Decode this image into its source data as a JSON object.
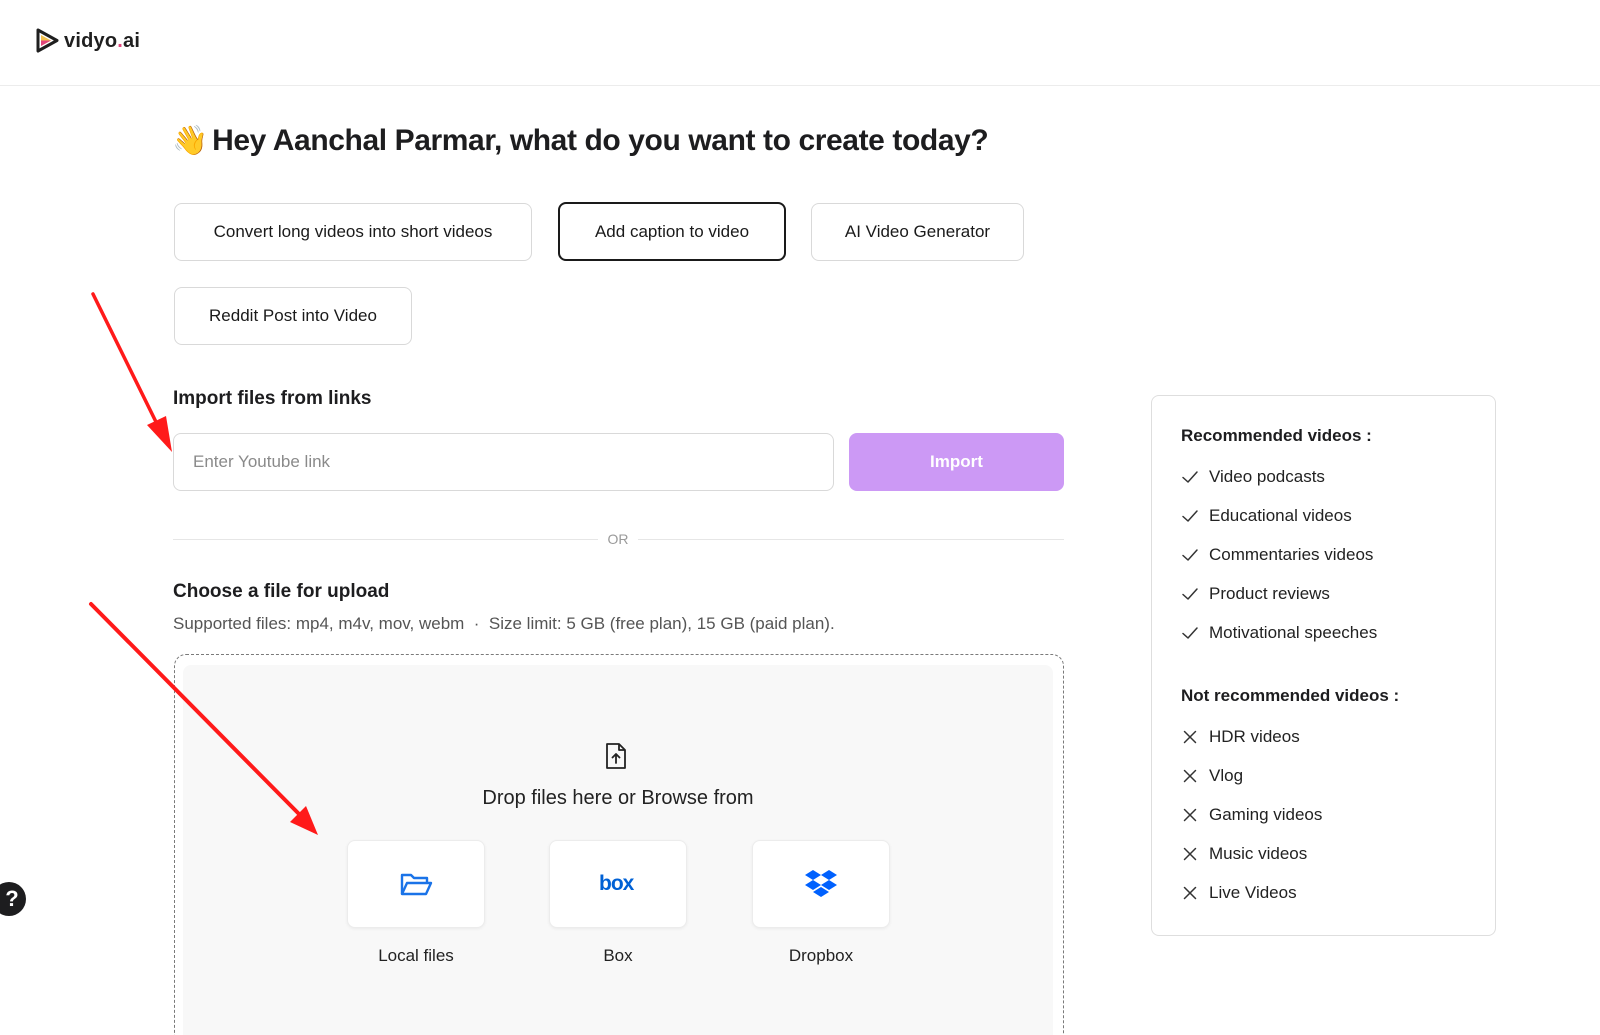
{
  "header": {
    "logo_main": "vidyo",
    "logo_dot": ".",
    "logo_suffix": "ai"
  },
  "greeting": {
    "emoji": "👋",
    "text": "Hey Aanchal Parmar, what do you want to create today?"
  },
  "options": [
    {
      "label": "Convert long videos into short videos",
      "selected": false
    },
    {
      "label": "Add caption to video",
      "selected": true
    },
    {
      "label": "AI Video Generator",
      "selected": false
    },
    {
      "label": "Reddit Post into Video",
      "selected": false
    }
  ],
  "import": {
    "title": "Import files from links",
    "placeholder": "Enter Youtube link",
    "button": "Import",
    "or": "OR"
  },
  "upload": {
    "title": "Choose a file for upload",
    "supported": "Supported files: mp4, m4v, mov, webm  ·  Size limit: 5 GB (free plan), 15 GB (paid plan).",
    "drop_text": "Drop files here or Browse from",
    "sources": [
      {
        "label": "Local files",
        "icon": "folder-open-icon"
      },
      {
        "label": "Box",
        "icon": "box-logo-icon"
      },
      {
        "label": "Dropbox",
        "icon": "dropbox-logo-icon"
      }
    ]
  },
  "recommendations": {
    "recommended_title": "Recommended videos :",
    "recommended": [
      "Video podcasts",
      "Educational videos",
      "Commentaries videos",
      "Product reviews",
      "Motivational speeches"
    ],
    "not_recommended_title": "Not recommended videos :",
    "not_recommended": [
      "HDR videos",
      "Vlog",
      "Gaming videos",
      "Music videos",
      "Live Videos"
    ]
  },
  "help": {
    "label": "?"
  },
  "colors": {
    "accent": "#cc99f5",
    "annotation_arrow": "#ff1a1a",
    "dropbox_blue": "#0061fe",
    "box_blue": "#0061d5",
    "folder_blue": "#1a73e8"
  }
}
